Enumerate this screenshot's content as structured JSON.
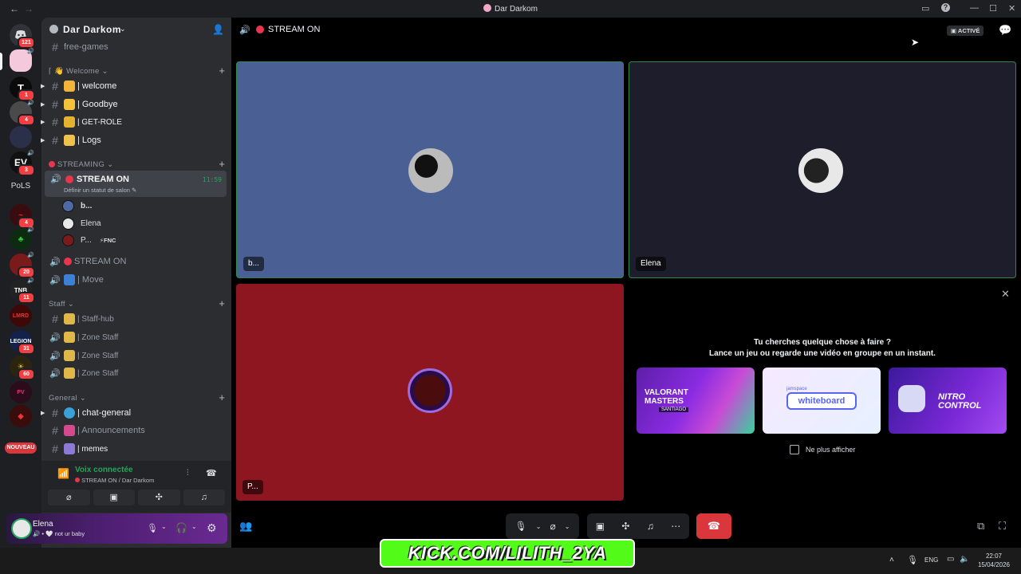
{
  "window": {
    "title": "Dar Darkom",
    "back": "←",
    "forward": "→"
  },
  "server": {
    "name": "Dar Darkom",
    "top_channel": "free-games"
  },
  "rail": {
    "dm_badge": "121",
    "badges": [
      "1",
      "4",
      "3",
      "4",
      "20",
      "11",
      "31",
      "60"
    ],
    "pols_label": "PoLS",
    "nouveau_label": "NOUVEAU"
  },
  "categories": {
    "welcome": "Welcome",
    "streaming": "STREAMING",
    "staff": "Staff",
    "general": "General"
  },
  "channels": {
    "welcome": "| welcome",
    "goodbye": "| Goodbye",
    "get_role": "| GET-ROLE",
    "logs": "| Logs",
    "stream_on": "STREAM ON",
    "stream_time": "11:59",
    "stream_status": "Définir un statut de salon",
    "stream_on_2": "STREAM ON",
    "move": "| Move",
    "staff_hub": "| Staff-hub",
    "zone_staff_1": "| Zone Staff",
    "zone_staff_2": "| Zone Staff",
    "zone_staff_3": "| Zone Staff",
    "chat_general": "| chat-general",
    "announcements": "| Announcements",
    "memes": "| memes"
  },
  "voice_members": [
    {
      "name": "b..."
    },
    {
      "name": "Elena"
    },
    {
      "name": "P...",
      "tag": "⚡FNC"
    }
  ],
  "voice_panel": {
    "status": "Voix connectée",
    "channel": "STREAM ON / Dar Darkom"
  },
  "user": {
    "name": "Elena",
    "status": "not ur baby"
  },
  "header": {
    "channel": "STREAM ON",
    "active_label": "ACTIVÉ"
  },
  "tiles": [
    {
      "label": "b...",
      "bg": "#4a5f93"
    },
    {
      "label": "Elena",
      "bg": "#1d1d2b"
    },
    {
      "label": "P...",
      "bg": "#8e1620"
    }
  ],
  "activity": {
    "line1": "Tu cherches quelque chose à faire ?",
    "line2": "Lance un jeu ou regarde une vidéo en groupe en un instant.",
    "cards": [
      {
        "title": "VALORANT MASTERS",
        "sub": "SANTIAGO"
      },
      {
        "title": "whiteboard",
        "sub": "jamspace"
      },
      {
        "title": "NITRO CONTROL",
        "sub": ""
      }
    ],
    "checkbox_label": "Ne plus afficher"
  },
  "overlay": {
    "text": "KICK.COM/LILITH_2YA"
  },
  "taskbar": {
    "lang": "ENG",
    "time": "22:07",
    "date": "15/04/2026"
  },
  "colors": {
    "accent_green": "#23a55a",
    "hangup_red": "#da373c",
    "brand": "#5865f2",
    "kick_green": "#53fc18"
  }
}
